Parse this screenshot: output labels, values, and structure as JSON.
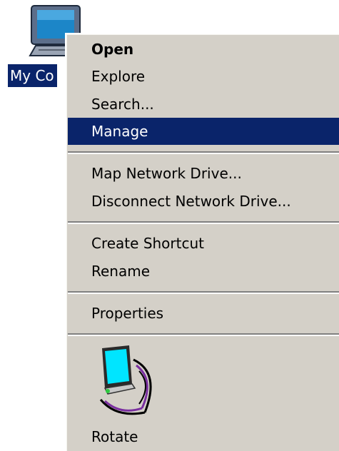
{
  "desktop": {
    "icon": {
      "name": "computer-icon",
      "label": "My Co"
    }
  },
  "context_menu": {
    "items": [
      {
        "label": "Open",
        "bold": true
      },
      {
        "label": "Explore"
      },
      {
        "label": "Search..."
      },
      {
        "label": "Manage",
        "highlighted": true
      },
      {
        "label": "Map Network Drive..."
      },
      {
        "label": "Disconnect Network Drive..."
      },
      {
        "label": "Create Shortcut"
      },
      {
        "label": "Rename"
      },
      {
        "label": "Properties"
      }
    ],
    "rotate": {
      "icon": "rotate-monitor-icon",
      "label": "Rotate"
    }
  },
  "colors": {
    "menu_background": "#d4d0c8",
    "highlight": "#0a246a",
    "highlight_text": "#ffffff",
    "separator_dark": "#808080",
    "separator_light": "#ffffff",
    "monitor_screen": "#00e5ff",
    "rotate_arc": "#7a2fa0"
  }
}
